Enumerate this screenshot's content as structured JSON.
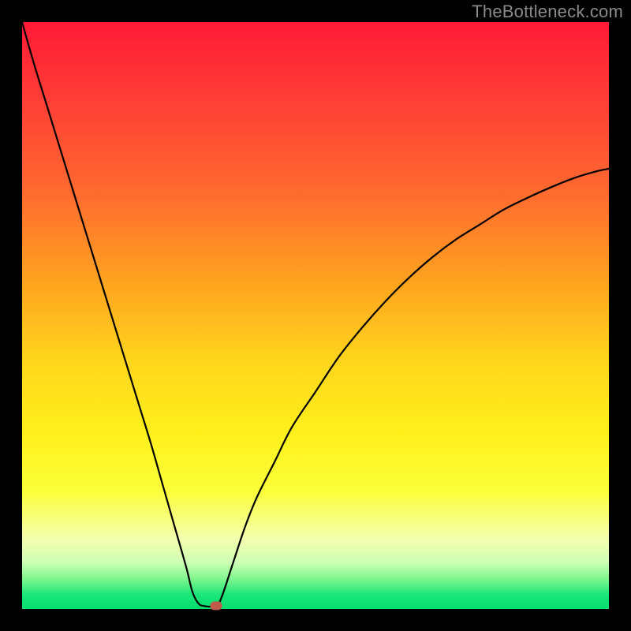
{
  "watermark": "TheBottleneck.com",
  "marker": {
    "color": "#c05a4a"
  },
  "chart_data": {
    "type": "line",
    "title": "",
    "xlabel": "",
    "ylabel": "",
    "xlim": [
      0,
      100
    ],
    "ylim": [
      0,
      100
    ],
    "grid": false,
    "legend": false,
    "series": [
      {
        "name": "left-branch",
        "x": [
          0,
          2,
          4,
          6,
          8,
          10,
          12,
          14,
          16,
          18,
          20,
          22,
          24,
          26,
          28,
          29,
          30,
          31
        ],
        "values": [
          100,
          93,
          86.5,
          80,
          73.5,
          67,
          60.5,
          54,
          47.5,
          41,
          34.5,
          28,
          21,
          14,
          7,
          3,
          1,
          0.5
        ]
      },
      {
        "name": "right-branch",
        "x": [
          33,
          34,
          36,
          38,
          40,
          43,
          46,
          50,
          54,
          58,
          62,
          66,
          70,
          74,
          78,
          82,
          86,
          90,
          94,
          98,
          100
        ],
        "values": [
          0.5,
          2,
          8,
          14,
          19,
          25,
          31,
          37,
          43,
          48,
          52.5,
          56.5,
          60,
          63,
          65.5,
          68,
          70,
          71.8,
          73.4,
          74.6,
          75
        ]
      }
    ],
    "annotations": [
      {
        "name": "marker",
        "x": 33,
        "y": 0.5
      }
    ],
    "background_gradient": {
      "type": "vertical",
      "stops": [
        {
          "pos": 0,
          "color": "#ff1a36"
        },
        {
          "pos": 50,
          "color": "#ffd61c"
        },
        {
          "pos": 90,
          "color": "#f4ffae"
        },
        {
          "pos": 100,
          "color": "#06de6e"
        }
      ]
    }
  }
}
